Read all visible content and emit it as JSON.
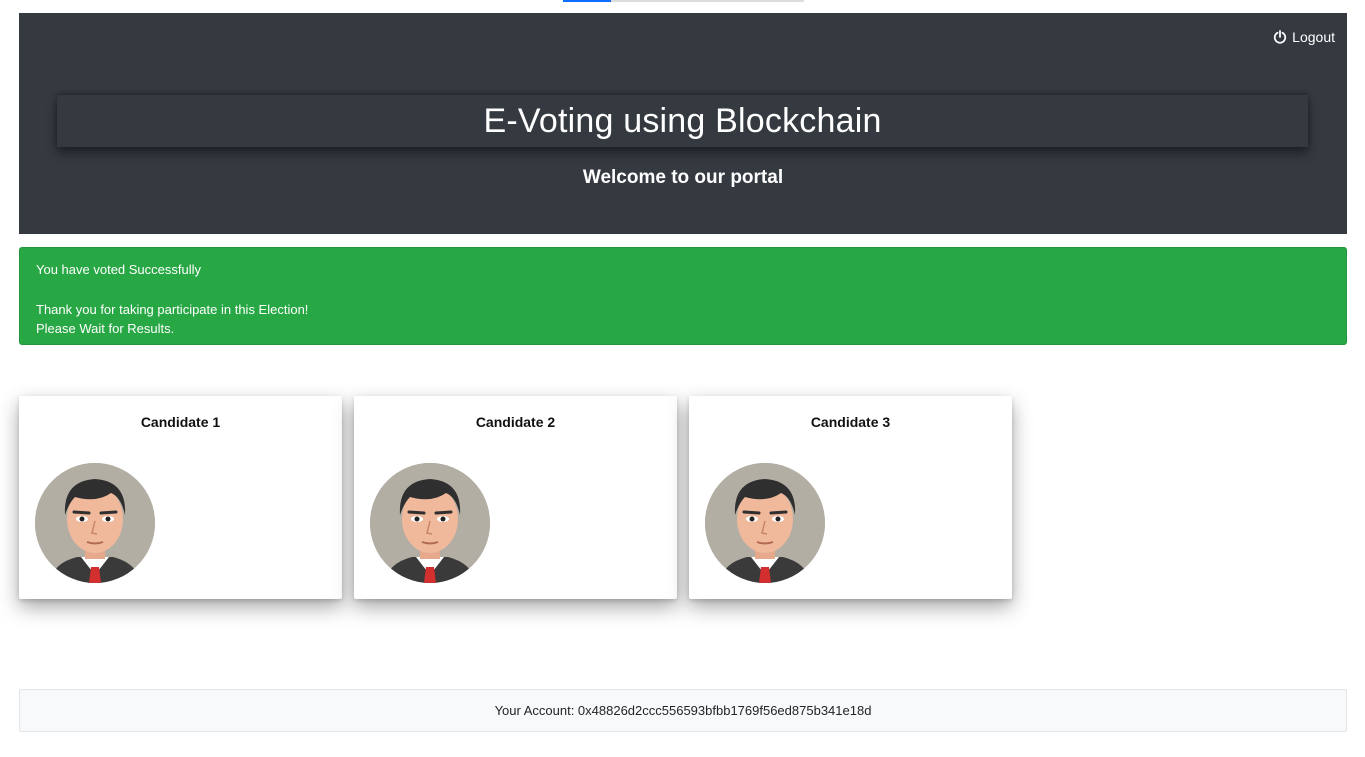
{
  "header": {
    "logout_label": "Logout",
    "title": "E-Voting using Blockchain",
    "subtitle": "Welcome to our portal"
  },
  "alert": {
    "line1": "You have voted Successfully",
    "line2": "Thank you for taking participate in this Election!",
    "line3": "Please Wait for Results."
  },
  "candidates": [
    {
      "name": "Candidate 1"
    },
    {
      "name": "Candidate 2"
    },
    {
      "name": "Candidate 3"
    }
  ],
  "footer": {
    "account_label": "Your Account: ",
    "account_address": "0x48826d2ccc556593bfbb1769f56ed875b341e18d"
  },
  "colors": {
    "header_bg": "#343a40",
    "alert_bg": "#28a745",
    "footer_bg": "#f8f9fa",
    "accent": "#0d6efd"
  },
  "icons": {
    "logout": "power-icon",
    "avatar": "person-avatar-icon"
  }
}
